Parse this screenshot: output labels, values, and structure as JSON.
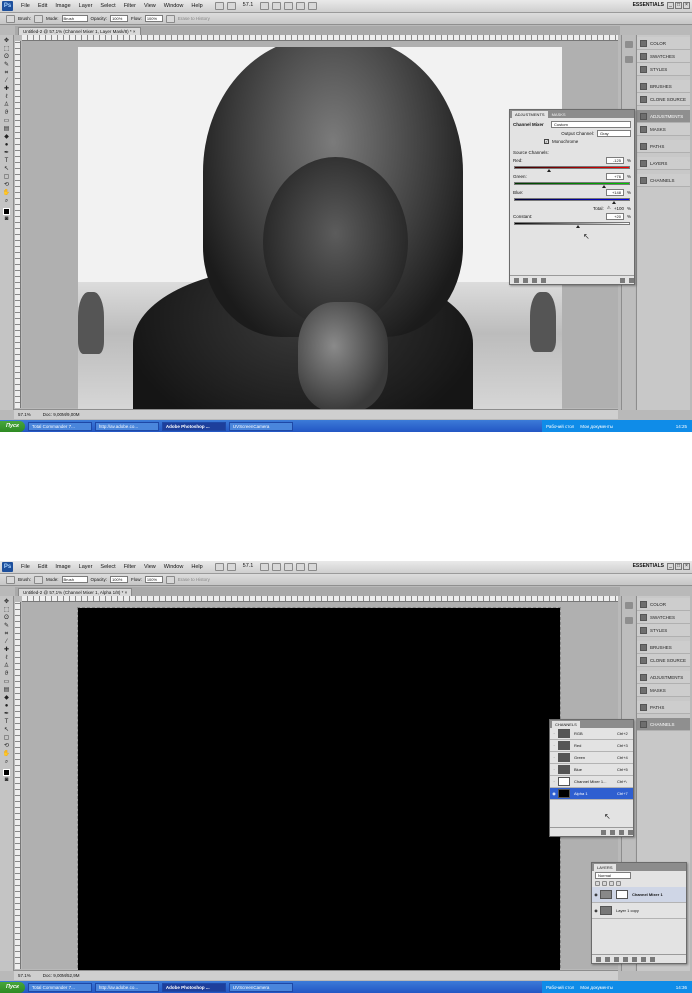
{
  "menu": {
    "ps_logo": "Ps",
    "items": [
      "File",
      "Edit",
      "Image",
      "Layer",
      "Select",
      "Filter",
      "View",
      "Window",
      "Help"
    ],
    "zoom": "57.1",
    "workspace": "ESSENTIALS"
  },
  "options": {
    "brush_label": "Brush:",
    "mode_label": "Mode:",
    "mode_value": "Brush",
    "opacity_label": "Opacity:",
    "opacity_value": "100%",
    "flow_label": "Flow:",
    "flow_value": "100%",
    "erase_history": "Erase to History"
  },
  "dock": {
    "group1": [
      "COLOR",
      "SWATCHES",
      "STYLES"
    ],
    "group2": [
      "BRUSHES",
      "CLONE SOURCE"
    ],
    "group3": [
      "ADJUSTMENTS",
      "MASKS"
    ],
    "group4": [
      "PATHS"
    ],
    "group5": [
      "LAYERS"
    ],
    "group6": [
      "CHANNELS"
    ]
  },
  "screen1": {
    "doc_tab": "Untitled-2 @ 57,1% (Channel Mixer 1, Layer Mask/8) * ×",
    "status_zoom": "57.1%",
    "status_doc": "Doc: 9,00M/9,00M",
    "adjustments": {
      "tab_active": "ADJUSTMENTS",
      "tab_other": "MASKS",
      "title": "Channel Mixer",
      "preset": "Custom",
      "output_label": "Output Channel:",
      "output_value": "Gray",
      "monochrome": "Monochrome",
      "source_label": "Source Channels:",
      "red_label": "Red:",
      "red_value": "-125",
      "green_label": "Green:",
      "green_value": "+76",
      "blue_label": "Blue:",
      "blue_value": "+148",
      "total_label": "Total:",
      "total_value": "+100",
      "constant_label": "Constant:",
      "constant_value": "+20",
      "pct": "%"
    },
    "sliders": {
      "red": 0.3,
      "green": 0.78,
      "blue": 0.87,
      "constant": 0.55
    }
  },
  "screen2": {
    "doc_tab": "Untitled-2 @ 57,1% (Channel Mixer 1, Alpha 1/8) * ×",
    "status_zoom": "57.1%",
    "status_doc": "Doc: 9,00M/52,9M",
    "channels": {
      "title": "CHANNELS",
      "rows": [
        {
          "name": "RGB",
          "shortcut": "Ctrl+2"
        },
        {
          "name": "Red",
          "shortcut": "Ctrl+3"
        },
        {
          "name": "Green",
          "shortcut": "Ctrl+4"
        },
        {
          "name": "Blue",
          "shortcut": "Ctrl+5"
        },
        {
          "name": "Channel Mixer 1...",
          "shortcut": "Ctrl+\\"
        },
        {
          "name": "Alpha 1",
          "shortcut": "Ctrl+7"
        }
      ]
    },
    "layers": {
      "title": "LAYERS",
      "blend": "Normal",
      "rows": [
        {
          "name": "Channel Mixer 1"
        },
        {
          "name": "Layer 1 copy"
        }
      ]
    }
  },
  "taskbar": {
    "start": "Пуск",
    "tasks": [
      "Total Commander 7...",
      "http://av.adobe.co...",
      "Adobe Photoshop ...",
      "UVScreenCamera"
    ],
    "tray_desktop": "Рабочий стол",
    "tray_docs": "Мои документы",
    "clock1": "14:25",
    "clock2": "14:36"
  }
}
